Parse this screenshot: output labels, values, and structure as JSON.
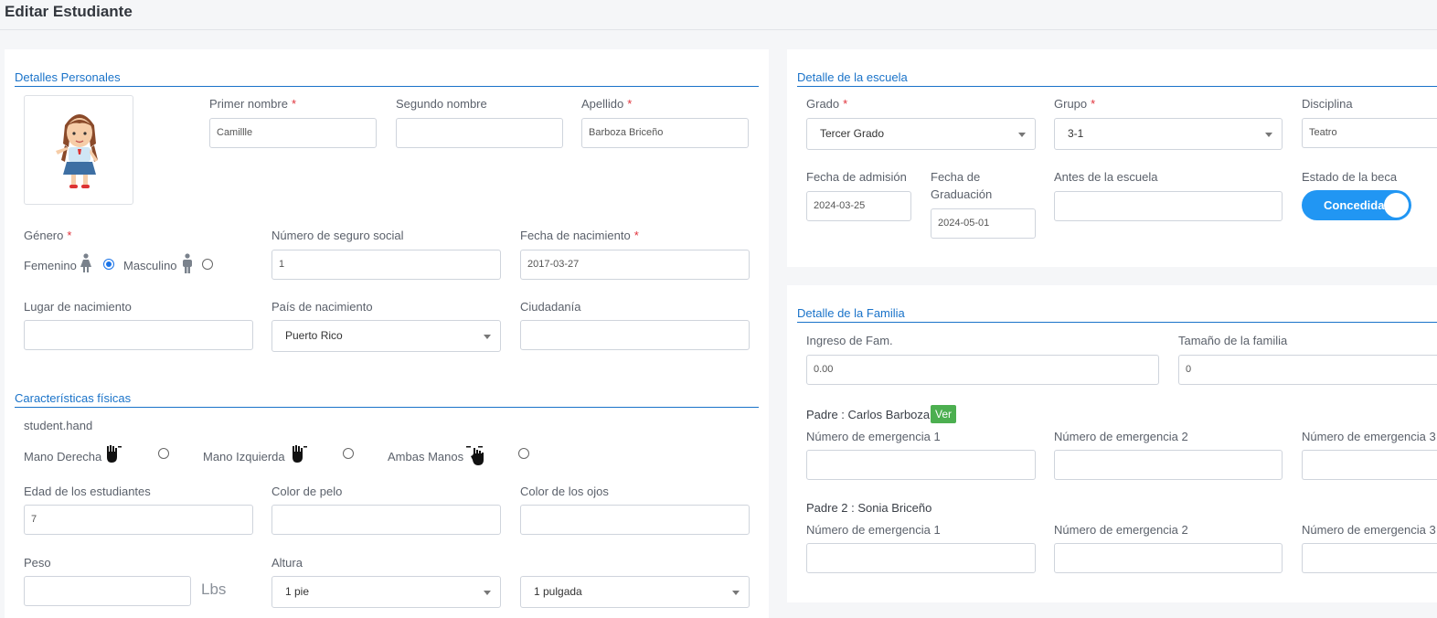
{
  "page": {
    "title": "Editar Estudiante"
  },
  "personal": {
    "section_title": "Detalles Personales",
    "first_name": {
      "label": "Primer nombre",
      "value": "Camillle"
    },
    "second_name": {
      "label": "Segundo nombre",
      "value": ""
    },
    "last_name": {
      "label": "Apellido",
      "value": "Barboza Briceño"
    },
    "gender": {
      "label": "Género",
      "female": "Femenino",
      "male": "Masculino",
      "selected": "Femenino"
    },
    "ssn": {
      "label": "Número de seguro social",
      "value": "1"
    },
    "birth_date": {
      "label": "Fecha de nacimiento",
      "value": "2017-03-27"
    },
    "birth_place": {
      "label": "Lugar de nacimiento",
      "value": ""
    },
    "birth_country": {
      "label": "País de nacimiento",
      "value": "Puerto Rico"
    },
    "citizenship": {
      "label": "Ciudadanía",
      "value": ""
    }
  },
  "physical": {
    "section_title": "Características físicas",
    "hand_label": "student.hand",
    "right_hand": "Mano Derecha",
    "left_hand": "Mano Izquierda",
    "both_hands": "Ambas Manos",
    "age": {
      "label": "Edad de los estudiantes",
      "value": "7"
    },
    "hair_color": {
      "label": "Color de pelo",
      "value": ""
    },
    "eye_color": {
      "label": "Color de los ojos",
      "value": ""
    },
    "weight": {
      "label": "Peso",
      "value": "",
      "unit": "Lbs"
    },
    "height": {
      "label": "Altura",
      "feet": "1 pie",
      "inches": "1 pulgada"
    }
  },
  "school": {
    "section_title": "Detalle de la escuela",
    "grade": {
      "label": "Grado",
      "value": "Tercer Grado"
    },
    "group": {
      "label": "Grupo",
      "value": "3-1"
    },
    "discipline": {
      "label": "Disciplina",
      "value": "Teatro"
    },
    "admission_date": {
      "label": "Fecha de admisión",
      "value": "2024-03-25"
    },
    "graduation_date": {
      "label_1": "Fecha de",
      "label_2": "Graduación",
      "value": "2024-05-01"
    },
    "prior_school": {
      "label": "Antes de la escuela",
      "value": ""
    },
    "scholarship": {
      "label": "Estado de la beca",
      "value": "Concedida"
    }
  },
  "family": {
    "section_title": "Detalle de la Familia",
    "income": {
      "label": "Ingreso de Fam.",
      "value": "0.00"
    },
    "size": {
      "label": "Tamaño de la familia",
      "value": "0"
    },
    "parent1": {
      "label": "Padre : ",
      "name": "Carlos Barboza",
      "view": "Ver"
    },
    "parent2": {
      "label": "Padre 2 : ",
      "name": "Sonia Briceño"
    },
    "emergency1": "Número de emergencia 1",
    "emergency2": "Número de emergencia 2",
    "emergency3": "Número de emergencia 3"
  },
  "colors": {
    "accent": "#1a73c9",
    "required": "#e0323b",
    "toggle": "#2196f3",
    "badge": "#4caf50"
  }
}
